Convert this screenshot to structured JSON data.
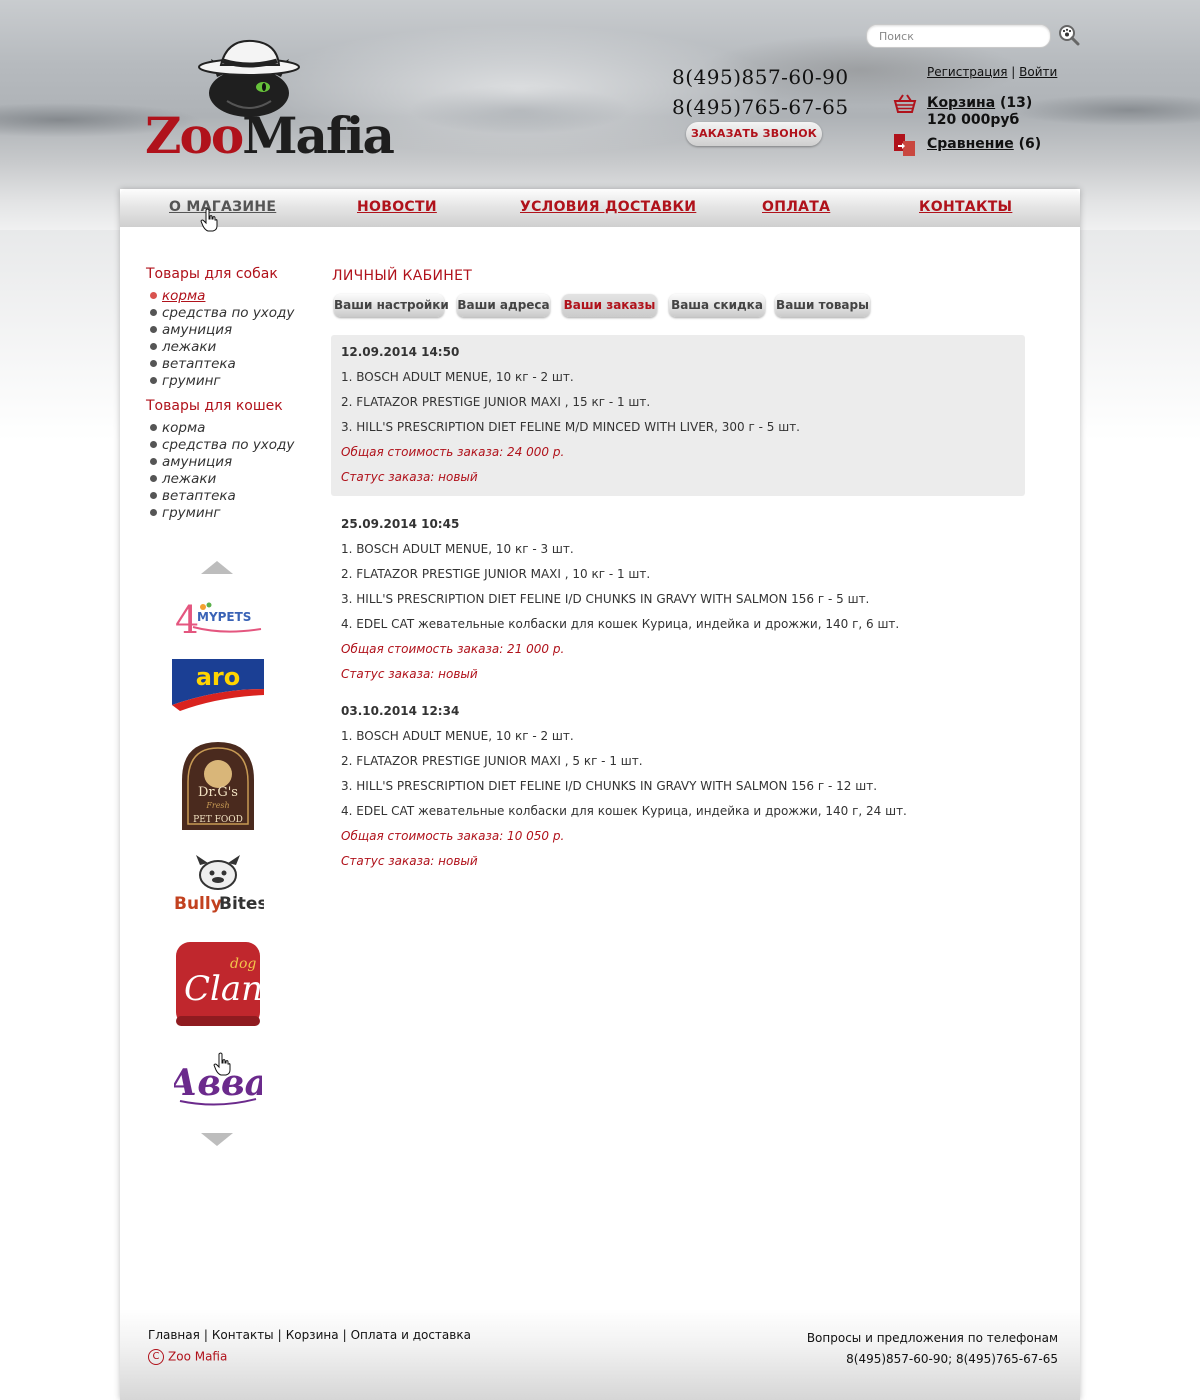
{
  "header": {
    "logo_text_zoo": "Zoo",
    "logo_text_mafia": "Mafia",
    "search_placeholder": "Поиск",
    "phones": [
      "8(495)857-60-90",
      "8(495)765-67-65"
    ],
    "callback_label": "ЗАКАЗАТЬ ЗВОНОК",
    "register_label": "Регистрация",
    "auth_separator": "|",
    "login_label": "Войти",
    "cart_label": "Корзина",
    "cart_count": "(13)",
    "cart_total": "120 000руб",
    "compare_label": "Сравнение",
    "compare_count": "(6)"
  },
  "nav": {
    "items": [
      {
        "label": "О МАГАЗИНЕ",
        "active": true
      },
      {
        "label": "НОВОСТИ"
      },
      {
        "label": "УСЛОВИЯ ДОСТАВКИ"
      },
      {
        "label": "ОПЛАТА"
      },
      {
        "label": "КОНТАКТЫ"
      }
    ]
  },
  "sidebar": {
    "dogs_title": "Товары для собак",
    "dogs_items": [
      "корма",
      "средства по уходу",
      "амуниция",
      "лежаки",
      "ветаптека",
      "груминг"
    ],
    "cats_title": "Товары для кошек",
    "cats_items": [
      "корма",
      "средства по уходу",
      "амуниция",
      "лежаки",
      "ветаптека",
      "груминг"
    ],
    "brands": [
      {
        "name": "4MYPETS",
        "icon": "4mypets-logo"
      },
      {
        "name": "aro",
        "icon": "aro-logo"
      },
      {
        "name": "Dr.G's Fresh Pet Food",
        "icon": "drgs-logo"
      },
      {
        "name": "Bully Bites",
        "icon": "bully-bites-logo"
      },
      {
        "name": "Clan dog",
        "icon": "clan-dog-logo"
      },
      {
        "name": "Авва",
        "icon": "avva-logo"
      }
    ]
  },
  "cabinet": {
    "title": "ЛИЧНЫЙ КАБИНЕТ",
    "tabs": [
      "Ваши настройки",
      "Ваши адреса",
      "Ваши заказы",
      "Ваша скидка",
      "Ваши товары"
    ],
    "active_tab": "Ваши заказы",
    "orders": [
      {
        "date": "12.09.2014 14:50",
        "items": [
          "1. BOSCH ADULT MENUE, 10 кг - 2 шт.",
          "2. FLATAZOR PRESTIGE JUNIOR MAXI , 15 кг - 1 шт.",
          "3. HILL'S PRESCRIPTION DIET FELINE M/D MINCED WITH LIVER, 300 г - 5 шт."
        ],
        "total": "Общая стоимость заказа: 24 000 р.",
        "status": "Статус заказа: новый"
      },
      {
        "date": "25.09.2014 10:45",
        "items": [
          "1. BOSCH ADULT MENUE, 10 кг - 3 шт.",
          "2. FLATAZOR PRESTIGE JUNIOR MAXI , 10 кг - 1 шт.",
          "3. HILL'S PRESCRIPTION DIET FELINE I/D CHUNKS IN GRAVY WITH SALMON  156 г - 5 шт.",
          "4. EDEL CAT жевательные колбаски для кошек Курица, индейка и дрожжи, 140 г, 6 шт."
        ],
        "total": "Общая стоимость заказа: 21 000 р.",
        "status": "Статус заказа: новый"
      },
      {
        "date": "03.10.2014 12:34",
        "items": [
          "1. BOSCH ADULT MENUE, 10 кг - 2 шт.",
          "2. FLATAZOR PRESTIGE JUNIOR MAXI , 5 кг - 1 шт.",
          "3. HILL'S PRESCRIPTION DIET FELINE I/D CHUNKS IN GRAVY WITH SALMON  156 г - 12 шт.",
          "4. EDEL CAT жевательные колбаски для кошек Курица, индейка и дрожжи, 140 г, 24 шт."
        ],
        "total": "Общая стоимость заказа: 10 050 р.",
        "status": "Статус заказа: новый"
      }
    ]
  },
  "footer": {
    "links": [
      "Главная",
      "Контакты",
      "Корзина",
      "Оплата и доставка"
    ],
    "separator": "|",
    "copyright_symbol": "C",
    "copyright": "Zoo Mafia",
    "contact_line1": "Вопросы и предложения по телефонам",
    "contact_line2": "8(495)857-60-90; 8(495)765-67-65"
  },
  "colors": {
    "accent": "#b0121b",
    "text": "#333333",
    "order_highlight": "#ececec"
  }
}
